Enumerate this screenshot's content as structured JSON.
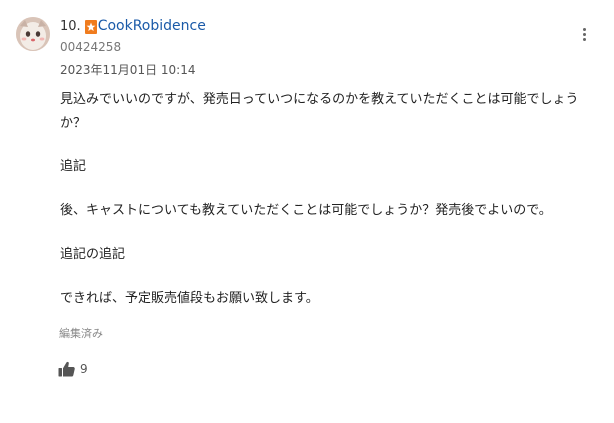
{
  "comment": {
    "rank": "10.",
    "username": "CookRobidence",
    "user_id": "00424258",
    "timestamp": "2023年11月01日 10:14",
    "paragraphs": [
      "見込みでいいのですが、発売日っていつになるのかを教えていただくことは可能でしょうか？",
      "追記",
      "後、キャストについても教えていただくことは可能でしょうか？発売後でよいので。",
      "追記の追記",
      "できれば、予定販売値段もお願い致します。"
    ],
    "edited_label": "編集済み",
    "like_count": "9"
  },
  "icons": {
    "avatar": "avatar-image",
    "badge": "orange-star-badge-icon",
    "menu": "vertical-dots-icon",
    "like": "thumbs-up-icon"
  },
  "colors": {
    "username": "#1a5aa8",
    "badge": "#f07c1e",
    "muted": "#888888"
  }
}
